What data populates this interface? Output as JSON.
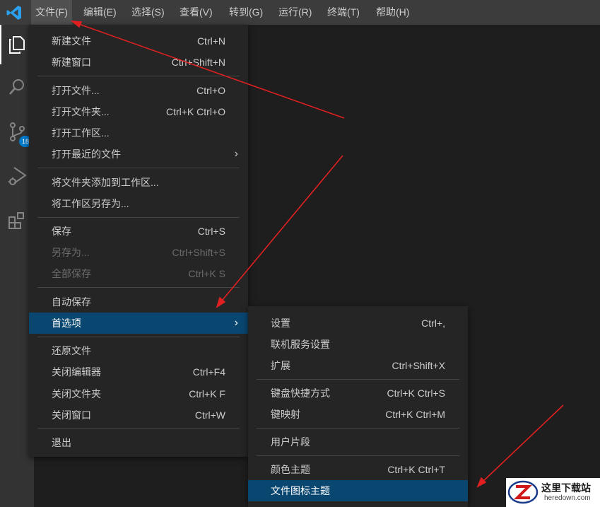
{
  "menubar": {
    "items": [
      "文件(F)",
      "编辑(E)",
      "选择(S)",
      "查看(V)",
      "转到(G)",
      "运行(R)",
      "终端(T)",
      "帮助(H)"
    ]
  },
  "activitybar": {
    "icons": [
      "files-icon",
      "search-icon",
      "source-control-icon",
      "run-debug-icon",
      "extensions-icon"
    ],
    "scm_badge": "18"
  },
  "file_menu": {
    "items": [
      {
        "label": "新建文件",
        "shortcut": "Ctrl+N"
      },
      {
        "label": "新建窗口",
        "shortcut": "Ctrl+Shift+N"
      },
      {
        "label": "打开文件...",
        "shortcut": "Ctrl+O"
      },
      {
        "label": "打开文件夹...",
        "shortcut": "Ctrl+K Ctrl+O"
      },
      {
        "label": "打开工作区...",
        "shortcut": ""
      },
      {
        "label": "打开最近的文件",
        "shortcut": ""
      },
      {
        "label": "将文件夹添加到工作区...",
        "shortcut": ""
      },
      {
        "label": "将工作区另存为...",
        "shortcut": ""
      },
      {
        "label": "保存",
        "shortcut": "Ctrl+S"
      },
      {
        "label": "另存为...",
        "shortcut": "Ctrl+Shift+S"
      },
      {
        "label": "全部保存",
        "shortcut": "Ctrl+K S"
      },
      {
        "label": "自动保存",
        "shortcut": ""
      },
      {
        "label": "首选项",
        "shortcut": ""
      },
      {
        "label": "还原文件",
        "shortcut": ""
      },
      {
        "label": "关闭编辑器",
        "shortcut": "Ctrl+F4"
      },
      {
        "label": "关闭文件夹",
        "shortcut": "Ctrl+K F"
      },
      {
        "label": "关闭窗口",
        "shortcut": "Ctrl+W"
      },
      {
        "label": "退出",
        "shortcut": ""
      }
    ]
  },
  "prefs_menu": {
    "items": [
      {
        "label": "设置",
        "shortcut": "Ctrl+,"
      },
      {
        "label": "联机服务设置",
        "shortcut": ""
      },
      {
        "label": "扩展",
        "shortcut": "Ctrl+Shift+X"
      },
      {
        "label": "键盘快捷方式",
        "shortcut": "Ctrl+K Ctrl+S"
      },
      {
        "label": "键映射",
        "shortcut": "Ctrl+K Ctrl+M"
      },
      {
        "label": "用户片段",
        "shortcut": ""
      },
      {
        "label": "颜色主题",
        "shortcut": "Ctrl+K Ctrl+T"
      },
      {
        "label": "文件图标主题",
        "shortcut": ""
      }
    ]
  },
  "watermark": {
    "title": "这里下载站",
    "url": "heredown.com"
  },
  "colors": {
    "titlebar": "#3c3c3c",
    "activitybar": "#333333",
    "editor": "#1e1e1e",
    "menu_bg": "#252526",
    "highlight": "#094771",
    "badge": "#007acc",
    "annotation_arrow": "#e02020"
  }
}
